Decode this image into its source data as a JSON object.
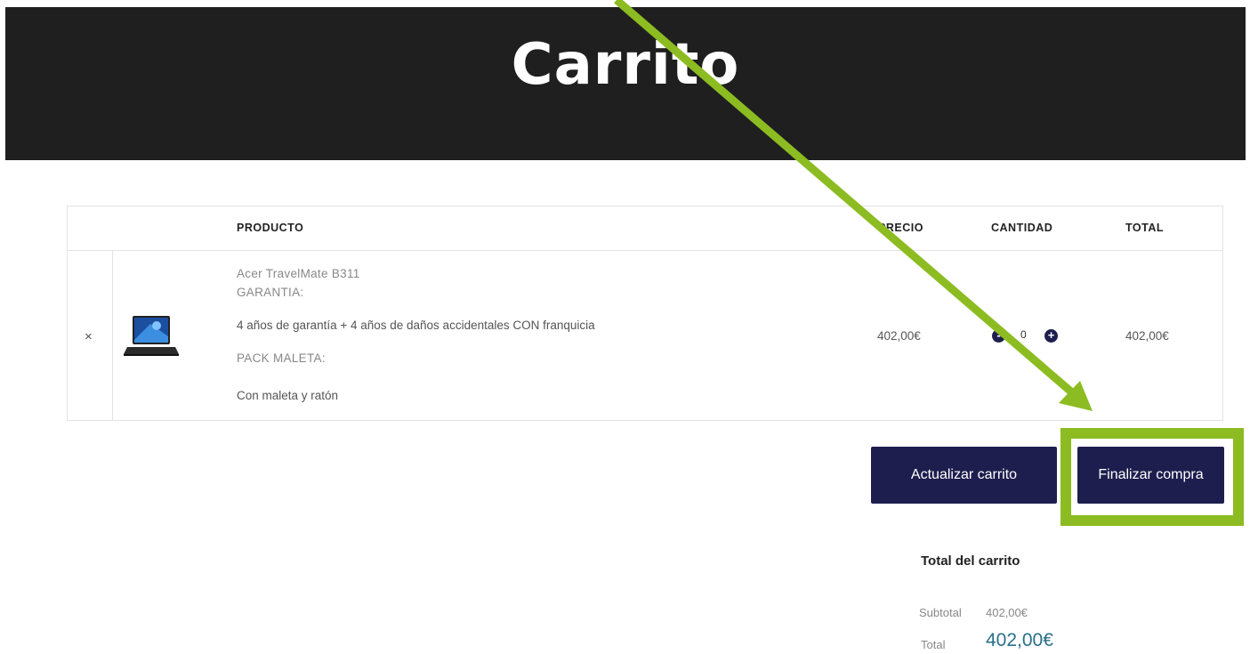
{
  "page": {
    "title": "Carrito"
  },
  "table": {
    "headers": {
      "product": "PRODUCTO",
      "price": "PRECIO",
      "quantity": "CANTIDAD",
      "total": "TOTAL"
    },
    "row": {
      "remove_symbol": "×",
      "product_name": "Acer TravelMate B311",
      "warranty_label": "GARANTIA:",
      "warranty_value": "4 años de garantía + 4 años de daños accidentales CON franquicia",
      "pack_label": "PACK MALETA:",
      "pack_value": "Con maleta y ratón",
      "price": "402,00€",
      "quantity": "0",
      "qty_minus": "-",
      "qty_plus": "+",
      "total": "402,00€"
    }
  },
  "actions": {
    "update": "Actualizar carrito",
    "checkout": "Finalizar compra"
  },
  "totals": {
    "title": "Total del carrito",
    "subtotal_label": "Subtotal",
    "subtotal_value": "402,00€",
    "total_label": "Total",
    "total_value": "402,00€"
  },
  "colors": {
    "header_bg": "#1f1f1f",
    "button_bg": "#1e1e4e",
    "annotation_green": "#8cbc21",
    "total_value": "#2a6f8a"
  },
  "icons": {
    "remove": "close-icon",
    "thumb": "laptop-thumbnail"
  }
}
